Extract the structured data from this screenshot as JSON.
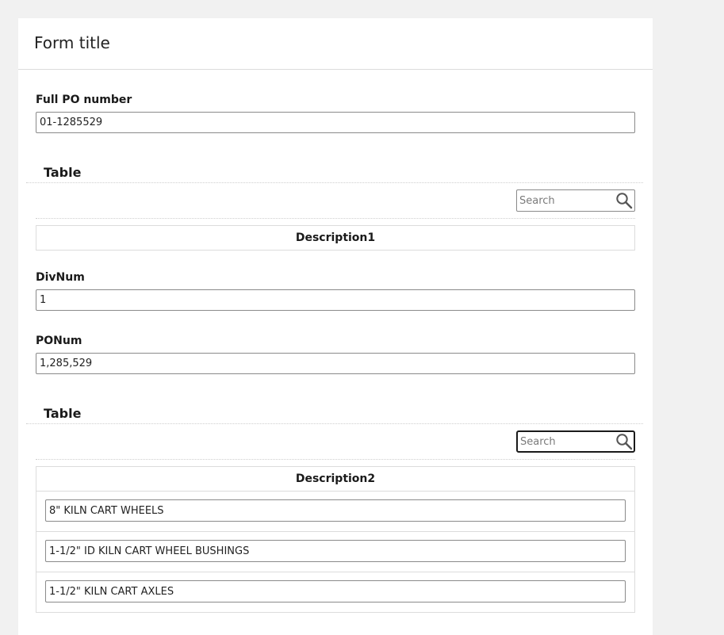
{
  "form": {
    "title": "Form title"
  },
  "fields": {
    "full_po_number": {
      "label": "Full PO number",
      "value": "01-1285529"
    },
    "div_num": {
      "label": "DivNum",
      "value": "1"
    },
    "po_num": {
      "label": "PONum",
      "value": "1,285,529"
    }
  },
  "table1": {
    "title": "Table",
    "search_placeholder": "Search",
    "column_header": "Description1",
    "rows": []
  },
  "table2": {
    "title": "Table",
    "search_placeholder": "Search",
    "column_header": "Description2",
    "rows": [
      {
        "description": "8\" KILN CART WHEELS"
      },
      {
        "description": "1-1/2\" ID KILN CART WHEEL BUSHINGS"
      },
      {
        "description": "1-1/2\" KILN CART AXLES"
      }
    ]
  },
  "icons": {
    "search": "search-icon"
  }
}
